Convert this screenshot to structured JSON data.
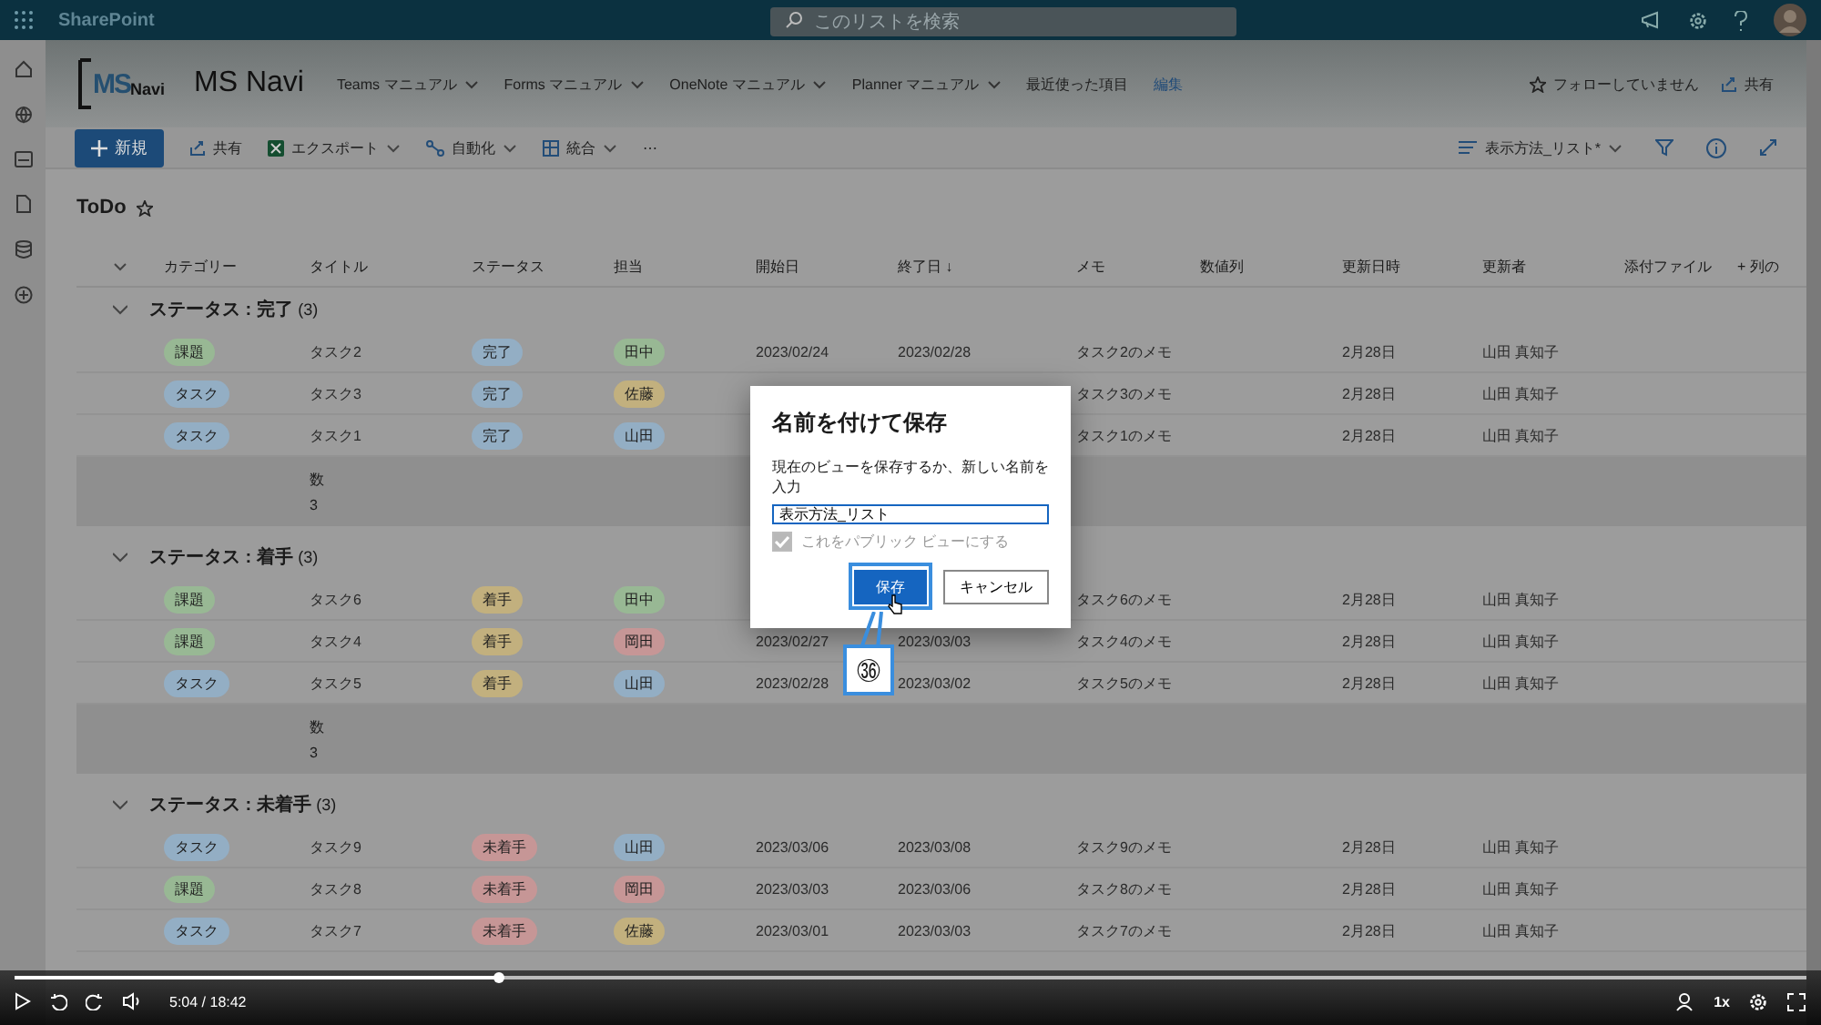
{
  "suite_bar": {
    "app_name": "SharePoint",
    "search": {
      "placeholder": "このリストを検索"
    }
  },
  "site": {
    "logo_text": "MS",
    "logo_sub": "Navi",
    "title": "MS Navi",
    "nav": [
      "Teams マニュアル",
      "Forms マニュアル",
      "OneNote マニュアル",
      "Planner マニュアル",
      "最近使った項目"
    ],
    "edit_link": "編集",
    "follow": "フォローしていません",
    "share": "共有"
  },
  "command_bar": {
    "new": "新規",
    "commands": [
      {
        "kind": "share",
        "label": "共有"
      },
      {
        "kind": "export",
        "label": "エクスポート"
      },
      {
        "kind": "automate",
        "label": "自動化"
      },
      {
        "kind": "integrate",
        "label": "統合"
      }
    ],
    "more": "⋯",
    "view": "表示方法_リスト*"
  },
  "list": {
    "title": "ToDo",
    "columns": [
      "カテゴリー",
      "タイトル",
      "ステータス",
      "担当",
      "開始日",
      "終了日 ↓",
      "メモ",
      "数値列",
      "更新日時",
      "更新者",
      "添付ファイル",
      "+ 列の"
    ],
    "groups": [
      {
        "label": "ステータス : 完了",
        "count": "(3)",
        "expanded": true,
        "footer": {
          "label": "数",
          "value": "3"
        },
        "rows": [
          {
            "category": {
              "text": "課題",
              "color": "#98b894"
            },
            "title": "タスク2",
            "status": {
              "text": "完了",
              "color": "#93aec4"
            },
            "assignee": {
              "text": "田中",
              "color": "#98b894"
            },
            "start": "2023/02/24",
            "end": "2023/02/28",
            "memo": "タスク2のメモ",
            "modified": "2月28日",
            "modified_by": "山田 真知子"
          },
          {
            "category": {
              "text": "タスク",
              "color": "#93aec4"
            },
            "title": "タスク3",
            "status": {
              "text": "完了",
              "color": "#93aec4"
            },
            "assignee": {
              "text": "佐藤",
              "color": "#c2b07e"
            },
            "memo": "タスク3のメモ",
            "modified": "2月28日",
            "modified_by": "山田 真知子"
          },
          {
            "category": {
              "text": "タスク",
              "color": "#93aec4"
            },
            "title": "タスク1",
            "status": {
              "text": "完了",
              "color": "#93aec4"
            },
            "assignee": {
              "text": "山田",
              "color": "#93aec4"
            },
            "memo": "タスク1のメモ",
            "modified": "2月28日",
            "modified_by": "山田 真知子"
          }
        ]
      },
      {
        "label": "ステータス : 着手",
        "count": "(3)",
        "expanded": true,
        "footer": {
          "label": "数",
          "value": "3"
        },
        "rows": [
          {
            "category": {
              "text": "課題",
              "color": "#98b894"
            },
            "title": "タスク6",
            "status": {
              "text": "着手",
              "color": "#c2b07e"
            },
            "assignee": {
              "text": "田中",
              "color": "#98b894"
            },
            "memo": "タスク6のメモ",
            "modified": "2月28日",
            "modified_by": "山田 真知子"
          },
          {
            "category": {
              "text": "課題",
              "color": "#98b894"
            },
            "title": "タスク4",
            "status": {
              "text": "着手",
              "color": "#c2b07e"
            },
            "assignee": {
              "text": "岡田",
              "color": "#c69696"
            },
            "start": "2023/02/27",
            "end": "2023/03/03",
            "memo": "タスク4のメモ",
            "modified": "2月28日",
            "modified_by": "山田 真知子"
          },
          {
            "category": {
              "text": "タスク",
              "color": "#93aec4"
            },
            "title": "タスク5",
            "status": {
              "text": "着手",
              "color": "#c2b07e"
            },
            "assignee": {
              "text": "山田",
              "color": "#93aec4"
            },
            "start": "2023/02/28",
            "end": "2023/03/02",
            "memo": "タスク5のメモ",
            "modified": "2月28日",
            "modified_by": "山田 真知子"
          }
        ]
      },
      {
        "label": "ステータス : 未着手",
        "count": "(3)",
        "expanded": true,
        "rows": [
          {
            "category": {
              "text": "タスク",
              "color": "#93aec4"
            },
            "title": "タスク9",
            "status": {
              "text": "未着手",
              "color": "#c69696"
            },
            "assignee": {
              "text": "山田",
              "color": "#93aec4"
            },
            "start": "2023/03/06",
            "end": "2023/03/08",
            "memo": "タスク9のメモ",
            "modified": "2月28日",
            "modified_by": "山田 真知子"
          },
          {
            "category": {
              "text": "課題",
              "color": "#98b894"
            },
            "title": "タスク8",
            "status": {
              "text": "未着手",
              "color": "#c69696"
            },
            "assignee": {
              "text": "岡田",
              "color": "#c69696"
            },
            "start": "2023/03/03",
            "end": "2023/03/06",
            "memo": "タスク8のメモ",
            "modified": "2月28日",
            "modified_by": "山田 真知子"
          },
          {
            "category": {
              "text": "タスク",
              "color": "#93aec4"
            },
            "title": "タスク7",
            "status": {
              "text": "未着手",
              "color": "#c69696"
            },
            "assignee": {
              "text": "佐藤",
              "color": "#c2b07e"
            },
            "start": "2023/03/01",
            "end": "2023/03/03",
            "memo": "タスク7のメモ",
            "modified": "2月28日",
            "modified_by": "山田 真知子"
          }
        ]
      }
    ]
  },
  "dialog": {
    "title": "名前を付けて保存",
    "description": "現在のビューを保存するか、新しい名前を入力",
    "name_value": "表示方法_リスト",
    "public_checkbox": {
      "label": "これをパブリック ビューにする",
      "checked": true,
      "disabled": true
    },
    "save": "保存",
    "cancel": "キャンセル"
  },
  "callout": {
    "number": "㊱"
  },
  "video_controls": {
    "time": "5:04 / 18:42",
    "level": 0.27,
    "speed": "1x"
  }
}
